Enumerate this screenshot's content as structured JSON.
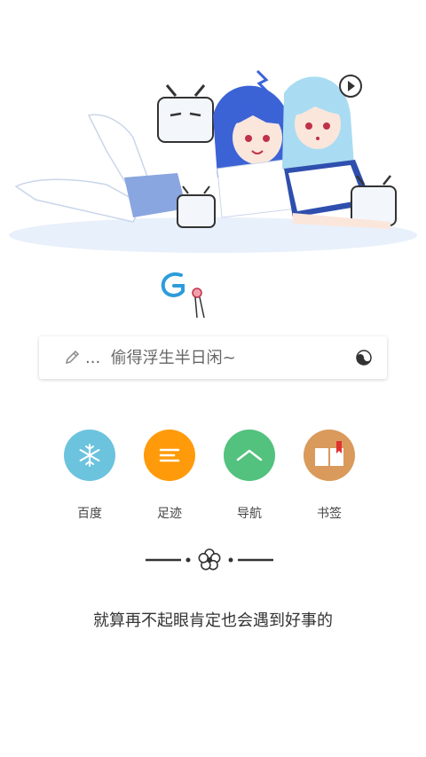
{
  "search": {
    "placeholder": "...  偷得浮生半日闲~",
    "leading_icon": "pencil-icon",
    "trailing_icon": "yin-yang-icon"
  },
  "logo": {
    "name": "g-logo"
  },
  "quick_links": [
    {
      "label": "百度",
      "icon": "snowflake-icon",
      "color": "#6cc3de"
    },
    {
      "label": "足迹",
      "icon": "lines-icon",
      "color": "#ff9b0a"
    },
    {
      "label": "导航",
      "icon": "chevron-up-icon",
      "color": "#52c27e"
    },
    {
      "label": "书签",
      "icon": "book-icon",
      "color": "#d99a5b"
    }
  ],
  "divider_icon": "flower-icon",
  "motto": "就算再不起眼肯定也会遇到好事的"
}
